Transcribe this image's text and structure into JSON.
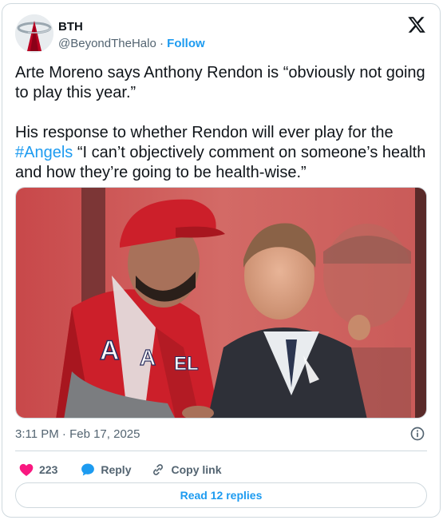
{
  "author": {
    "name": "BTH",
    "handle": "@BeyondTheHalo",
    "separator": "·",
    "follow_label": "Follow"
  },
  "tweet": {
    "paragraph1": "Arte Moreno says Anthony Rendon is “obviously not going to play this year.”",
    "paragraph2_before": "His response to whether Rendon will ever play for the ",
    "hashtag": "#Angels",
    "paragraph2_after": " “I can’t objectively comment on someone’s health and how they’re going to be health-wise.”",
    "timestamp": "3:11 PM · Feb 17, 2025"
  },
  "actions": {
    "like_count": "223",
    "reply_label": "Reply",
    "copy_link_label": "Copy link"
  },
  "read_replies_label": "Read 12 replies",
  "colors": {
    "link_blue": "#1d9bf0",
    "like_pink": "#f91880",
    "muted_text": "#536471",
    "angels_red": "#ba0021"
  }
}
